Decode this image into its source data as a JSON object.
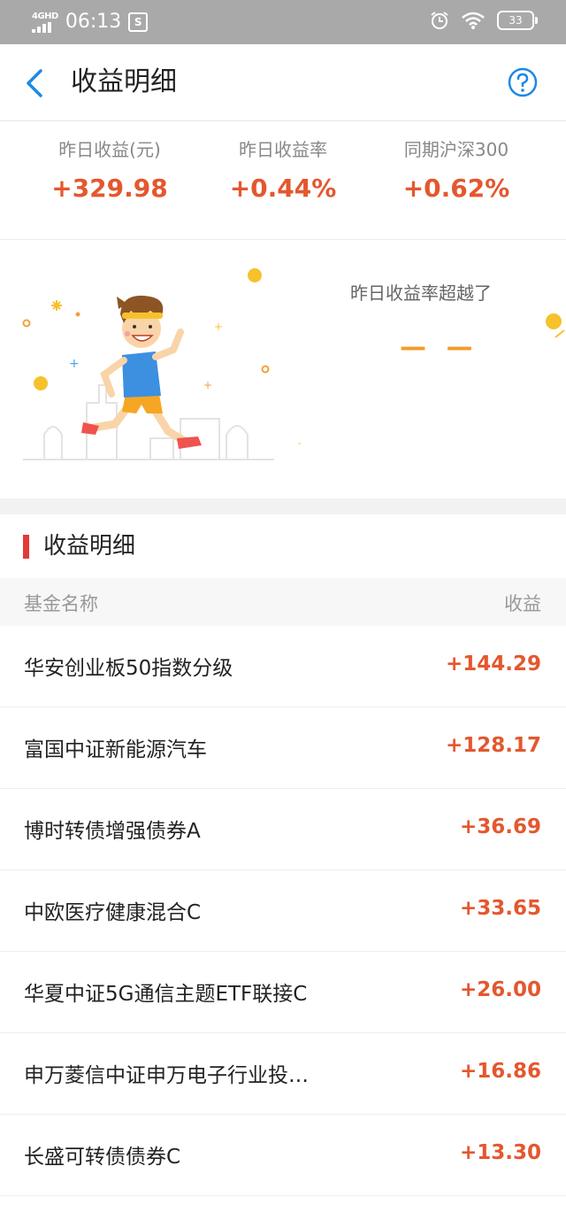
{
  "status_bar": {
    "network": "4GHD",
    "time": "06:13",
    "sim_icon": "sim-card-icon",
    "battery": "33"
  },
  "nav": {
    "title": "收益明细",
    "back_icon": "chevron-left-icon",
    "help_icon": "question-circle-icon"
  },
  "summary": [
    {
      "label": "昨日收益(元)",
      "value": "+329.98"
    },
    {
      "label": "昨日收益率",
      "value": "+0.44%"
    },
    {
      "label": "同期沪深300",
      "value": "+0.62%"
    }
  ],
  "banner": {
    "text": "昨日收益率超越了",
    "value": "— —"
  },
  "section": {
    "title": "收益明细"
  },
  "table": {
    "col_name": "基金名称",
    "col_gain": "收益",
    "rows": [
      {
        "name": "华安创业板50指数分级",
        "gain": "+144.29"
      },
      {
        "name": "富国中证新能源汽车",
        "gain": "+128.17"
      },
      {
        "name": "博时转债增强债券A",
        "gain": "+36.69"
      },
      {
        "name": "中欧医疗健康混合C",
        "gain": "+33.65"
      },
      {
        "name": "华夏中证5G通信主题ETF联接C",
        "gain": "+26.00"
      },
      {
        "name": "申万菱信中证申万电子行业投…",
        "gain": "+16.86"
      },
      {
        "name": "长盛可转债债券C",
        "gain": "+13.30"
      }
    ]
  },
  "colors": {
    "accent_blue": "#1e88e5",
    "gain_red": "#e4572e",
    "section_bar": "#e53935"
  }
}
